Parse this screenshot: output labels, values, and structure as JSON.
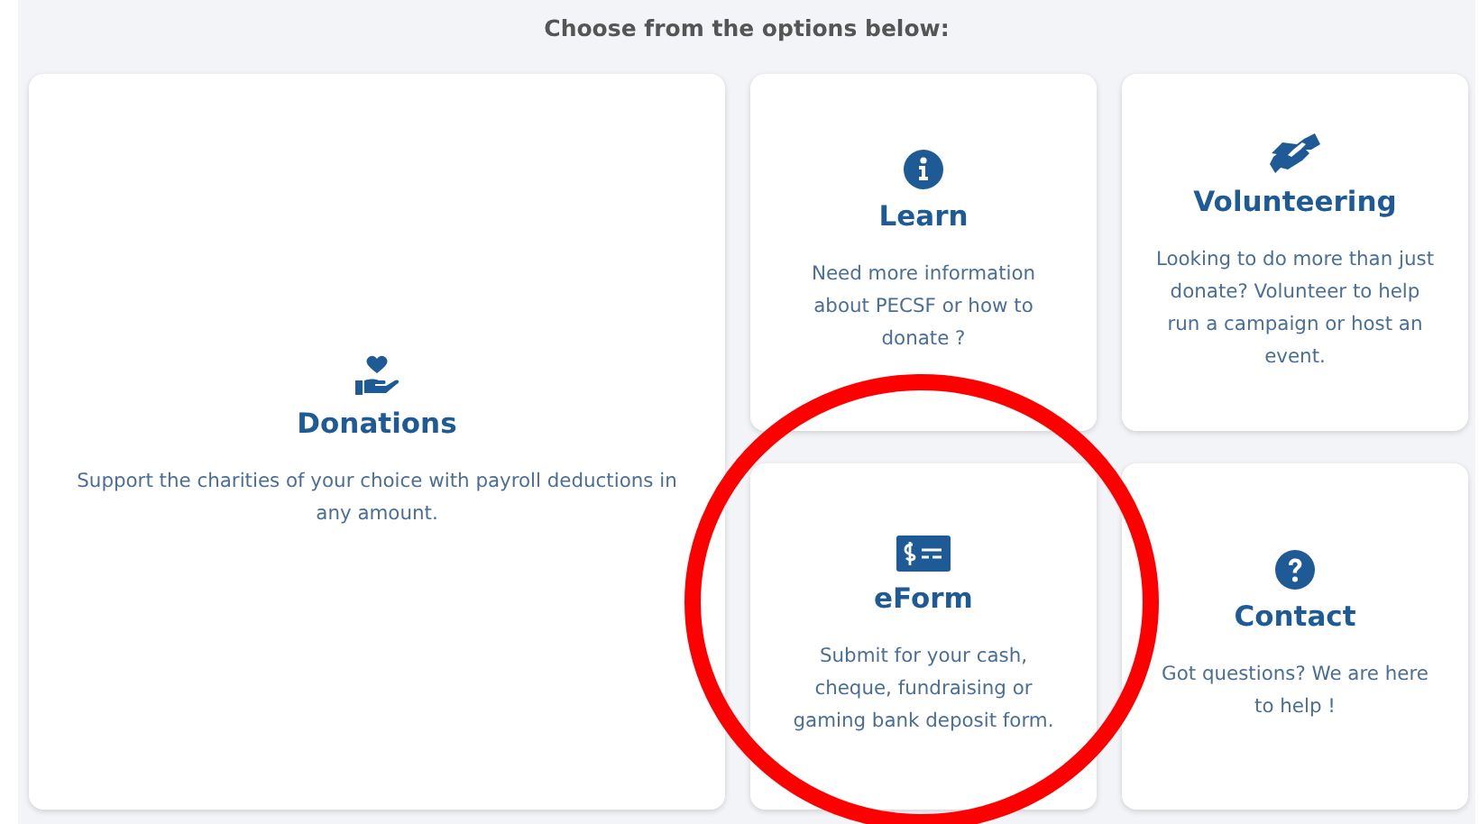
{
  "heading": "Choose from the options below:",
  "cards": [
    {
      "kind": "heart-hand",
      "title": "Donations",
      "text": "Support the charities of your choice with payroll deductions in any amount.",
      "highlighted": false
    },
    {
      "kind": "info",
      "title": "Learn",
      "text": "Need more information about PECSF or how to donate ?",
      "highlighted": false
    },
    {
      "kind": "handshake",
      "title": "Volunteering",
      "text": "Looking to do more than just donate? Volunteer to help run a campaign or host an event.",
      "highlighted": false
    },
    {
      "kind": "cheque",
      "title": "eForm",
      "text": "Submit for your cash, cheque, fundraising or gaming bank deposit form.",
      "highlighted": true
    },
    {
      "kind": "question",
      "title": "Contact",
      "text": "Got questions?  We are here to help !",
      "highlighted": false
    }
  ]
}
